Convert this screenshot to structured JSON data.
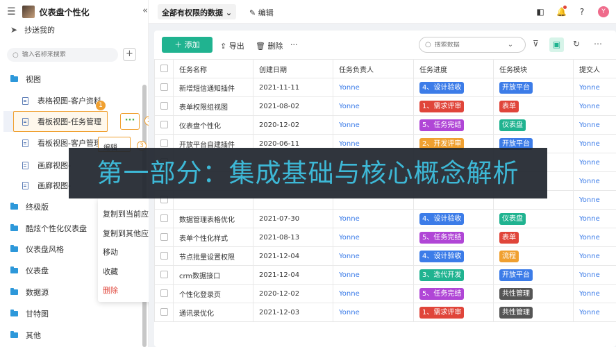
{
  "app": {
    "title": "仪表盘个性化"
  },
  "sidebar": {
    "cc_label": "抄送我的",
    "search_placeholder": "输入名称来搜索",
    "tree": {
      "view_folder": "视图",
      "items": [
        "表格视图-客户资料",
        "看板视图-任务管理",
        "看板视图-客户管理",
        "画廊视图-",
        "画廊视图-"
      ],
      "folders": [
        "终极版",
        "酷炫个性化仪表盘",
        "仪表盘风格",
        "仪表盘",
        "数据源",
        "甘特图",
        "其他"
      ]
    },
    "badges": [
      "1",
      "2",
      "3"
    ],
    "edit_label": "编辑",
    "context_menu": [
      "复制到当前应用",
      "复制到其他应用",
      "移动",
      "收藏",
      "删除"
    ]
  },
  "topbar": {
    "view_select": "全部有权限的数据",
    "edit_label": "编辑",
    "avatar_letter": "Y"
  },
  "toolbar": {
    "add_label": "添加",
    "export_label": "导出",
    "delete_label": "删除",
    "more_label": "···",
    "search_placeholder": "搜索数据"
  },
  "table": {
    "columns": [
      "任务名称",
      "创建日期",
      "任务负责人",
      "任务进度",
      "任务模块",
      "提交人"
    ],
    "rows": [
      {
        "name": "新增短信通知插件",
        "date": "2021-11-11",
        "owner": "Yonne",
        "progress": "4、设计验收",
        "pcolor": "#3c7ce8",
        "module": "开放平台",
        "mcolor": "#3c7ce8",
        "sub": "Yonne"
      },
      {
        "name": "表单权限组视图",
        "date": "2021-08-02",
        "owner": "Yonne",
        "progress": "1、需求评审",
        "pcolor": "#e0453a",
        "module": "表单",
        "mcolor": "#e0453a",
        "sub": "Yonne"
      },
      {
        "name": "仪表盘个性化",
        "date": "2020-12-02",
        "owner": "Yonne",
        "progress": "5、任务完结",
        "pcolor": "#b046d6",
        "module": "仪表盘",
        "mcolor": "#20b390",
        "sub": "Yonne"
      },
      {
        "name": "开放平台自建插件",
        "date": "2020-06-11",
        "owner": "Yonne",
        "progress": "2、开发评审",
        "pcolor": "#f0a030",
        "module": "开放平台",
        "mcolor": "#3c7ce8",
        "sub": "Yonne"
      },
      {
        "name": "",
        "date": "",
        "owner": "",
        "progress": "",
        "pcolor": "#3c7ce8",
        "module": "",
        "mcolor": "#3c7ce8",
        "sub": "Yonne"
      },
      {
        "name": "",
        "date": "",
        "owner": "",
        "progress": "",
        "pcolor": "#3c7ce8",
        "module": "",
        "mcolor": "#3c7ce8",
        "sub": "Yonne"
      },
      {
        "name": "",
        "date": "",
        "owner": "",
        "progress": "",
        "pcolor": "#20b390",
        "module": "",
        "mcolor": "#555555",
        "sub": "Yonne"
      },
      {
        "name": "数据管理表格优化",
        "date": "2021-07-30",
        "owner": "Yonne",
        "progress": "4、设计验收",
        "pcolor": "#3c7ce8",
        "module": "仪表盘",
        "mcolor": "#20b390",
        "sub": "Yonne"
      },
      {
        "name": "表单个性化样式",
        "date": "2021-08-13",
        "owner": "Yonne",
        "progress": "5、任务完结",
        "pcolor": "#b046d6",
        "module": "表单",
        "mcolor": "#e0453a",
        "sub": "Yonne"
      },
      {
        "name": "节点批量设置权限",
        "date": "2021-12-04",
        "owner": "Yonne",
        "progress": "4、设计验收",
        "pcolor": "#3c7ce8",
        "module": "流程",
        "mcolor": "#f0a030",
        "sub": "Yonne"
      },
      {
        "name": "crm数据接口",
        "date": "2021-12-04",
        "owner": "Yonne",
        "progress": "3、迭代开发",
        "pcolor": "#20b390",
        "module": "开放平台",
        "mcolor": "#3c7ce8",
        "sub": "Yonne"
      },
      {
        "name": "个性化登录页",
        "date": "2020-12-02",
        "owner": "Yonne",
        "progress": "5、任务完结",
        "pcolor": "#b046d6",
        "module": "共性管理",
        "mcolor": "#555555",
        "sub": "Yonne"
      },
      {
        "name": "通讯录优化",
        "date": "2021-12-03",
        "owner": "Yonne",
        "progress": "1、需求评审",
        "pcolor": "#e0453a",
        "module": "共性管理",
        "mcolor": "#555555",
        "sub": "Yonne"
      }
    ]
  },
  "banner": {
    "text": "第一部分：集成基础与核心概念解析"
  }
}
